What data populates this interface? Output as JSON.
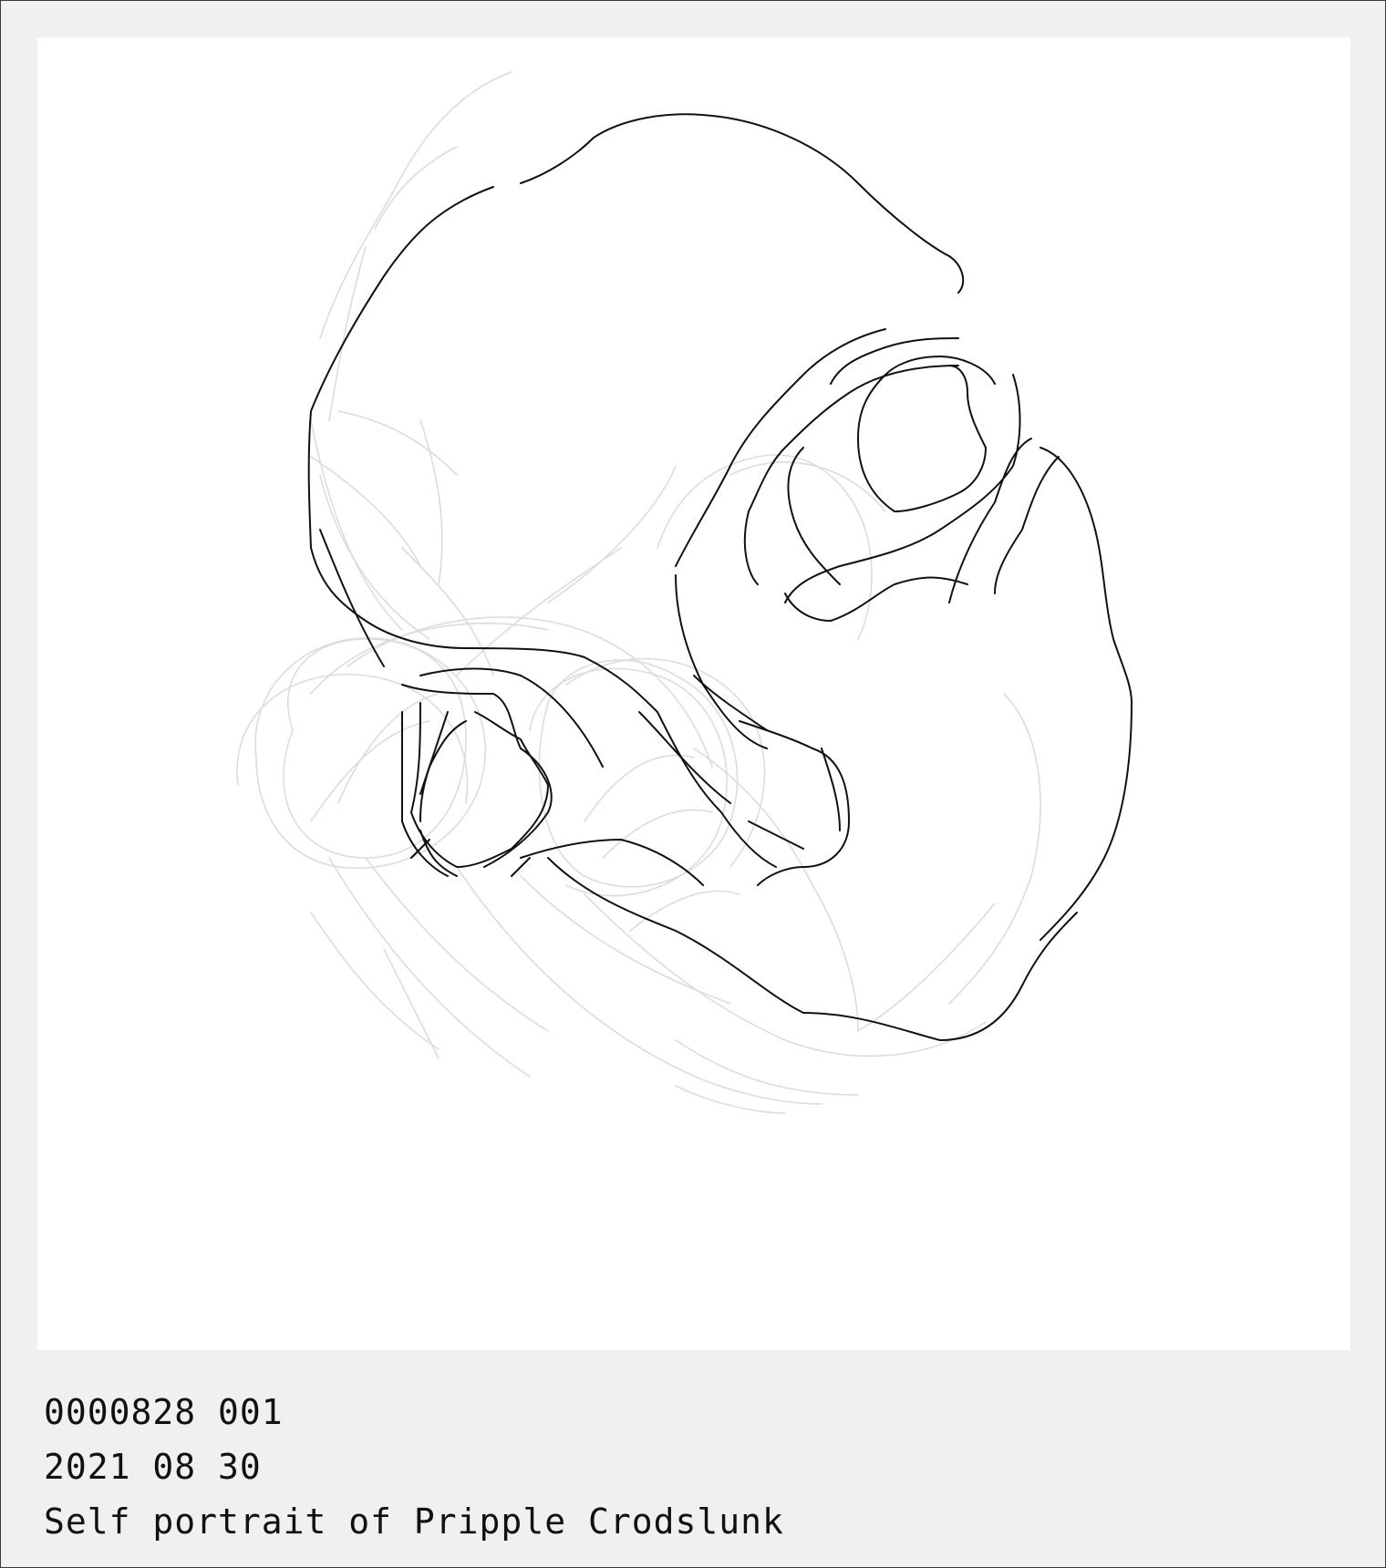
{
  "card": {
    "id_line": "0000828 001",
    "date_line": "2021 08 30",
    "title_line": "Self portrait of Pripple Crodslunk"
  },
  "colors": {
    "background": "#f0f0f0",
    "canvas": "#ffffff",
    "ink": "#111111",
    "sketch": "#dcdcdc",
    "border": "#3a3a3a"
  }
}
